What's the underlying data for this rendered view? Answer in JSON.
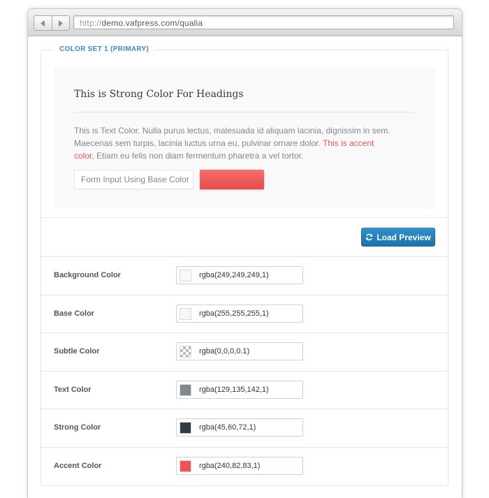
{
  "browser": {
    "url_protocol": "http://",
    "url_rest": "demo.vafpress.com/qualia",
    "back_icon": "triangle-left-icon",
    "forward_icon": "triangle-right-icon"
  },
  "section": {
    "legend": "COLOR SET 1 (PRIMARY)"
  },
  "preview": {
    "heading": "This is Strong Color For Headings",
    "body_text": "This is Text Color. Nulla purus lectus, malesuada id aliquam lacinia, dignissim in sem. Maecenas sem turpis, lacinia luctus urna eu, pulvinar ornare dolor. ",
    "accent_text": "This is accent color",
    "body_text_end": ", Etiam eu felis non diam fermentum pharetra a vel tortor.",
    "input_placeholder": "Form Input Using Base Color",
    "accent_button_label": ""
  },
  "load_preview": {
    "label": "Load Preview",
    "icon": "refresh-icon"
  },
  "colors": [
    {
      "label": "Background Color",
      "value": "rgba(249,249,249,1)",
      "swatch": "#f9f9f9"
    },
    {
      "label": "Base Color",
      "value": "rgba(255,255,255,1)",
      "swatch": "#ffffff"
    },
    {
      "label": "Subtle Color",
      "value": "rgba(0,0,0,0.1)",
      "swatch": "transparent-checker"
    },
    {
      "label": "Text Color",
      "value": "rgba(129,135,142,1)",
      "swatch": "#81878e"
    },
    {
      "label": "Strong Color",
      "value": "rgba(45,60,72,1)",
      "swatch": "#2d3c48"
    },
    {
      "label": "Accent Color",
      "value": "rgba(240,82,83,1)",
      "swatch": "#f05253"
    }
  ],
  "theme": {
    "accent": "#f05253",
    "primary_button": "#2580bb",
    "legend_color": "#3b8cc2"
  }
}
